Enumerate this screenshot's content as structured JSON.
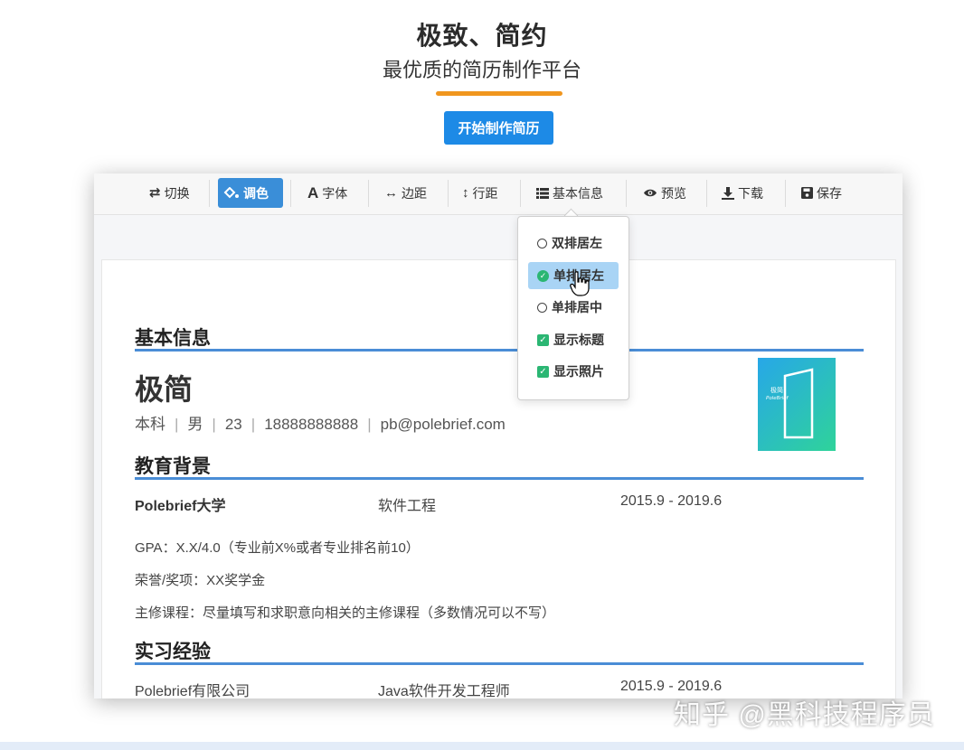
{
  "hero": {
    "title": "极致、简约",
    "subtitle": "最优质的简历制作平台",
    "cta_label": "开始制作简历"
  },
  "toolbar": {
    "items": [
      {
        "icon": "swap-icon",
        "label": "切换"
      },
      {
        "icon": "paint-bucket-icon",
        "label": "调色",
        "active": true
      },
      {
        "icon": "font-icon",
        "label": "字体"
      },
      {
        "icon": "horizontal-arrows-icon",
        "label": "边距"
      },
      {
        "icon": "vertical-arrows-icon",
        "label": "行距"
      },
      {
        "icon": "list-icon",
        "label": "基本信息"
      },
      {
        "icon": "eye-icon",
        "label": "预览"
      },
      {
        "icon": "download-icon",
        "label": "下载"
      },
      {
        "icon": "save-icon",
        "label": "保存"
      }
    ]
  },
  "dropdown": {
    "items": [
      {
        "label": "双排居左",
        "state": "radio-off"
      },
      {
        "label": "单排居左",
        "state": "radio-on"
      },
      {
        "label": "单排居中",
        "state": "radio-off"
      },
      {
        "label": "显示标题",
        "state": "checked"
      },
      {
        "label": "显示照片",
        "state": "checked"
      }
    ]
  },
  "resume": {
    "basic": {
      "heading": "基本信息",
      "name": "极简",
      "degree": "本科",
      "sep": "|",
      "gender": "男",
      "age": "23",
      "phone": "18888888888",
      "email": "pb@polebrief.com",
      "photo_text": "极简",
      "photo_subtext": "PoleBrief"
    },
    "education": {
      "heading": "教育背景",
      "school": "Polebrief大学",
      "major": "软件工程",
      "period": "2015.9 - 2019.6",
      "gpa": "GPA：X.X/4.0（专业前X%或者专业排名前10）",
      "honors": "荣誉/奖项：XX奖学金",
      "courses": "主修课程：尽量填写和求职意向相关的主修课程（多数情况可以不写）"
    },
    "internship": {
      "heading": "实习经验",
      "company": "Polebrief有限公司",
      "position": "Java软件开发工程师",
      "period": "2015.9 - 2019.6"
    }
  },
  "watermark": "知乎 @黑科技程序员",
  "colors": {
    "accent_blue": "#1d8ae6",
    "active_tab": "#3a8ed8",
    "section_rule": "#4a8dd6",
    "hero_underline": "#f0961e",
    "check_green": "#2bb673",
    "selected_item": "#a9d4f5"
  }
}
